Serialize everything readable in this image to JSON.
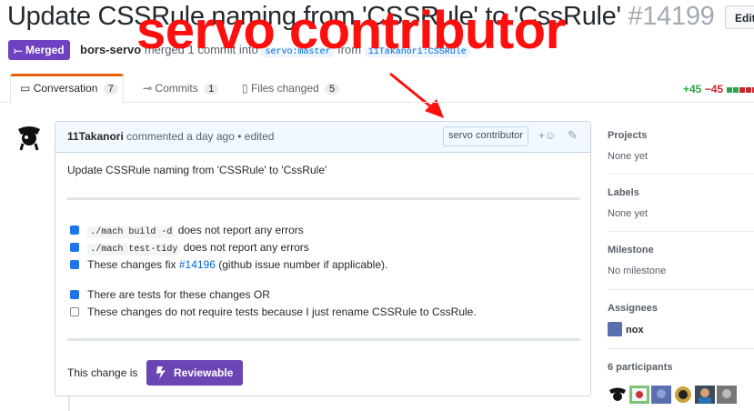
{
  "header": {
    "title": "Update CSSRule naming from 'CSSRule' to 'CssRule'",
    "number": "#14199",
    "edit_label": "Edit",
    "state_badge": "Merged",
    "author": "bors-servo",
    "meta_text": "merged 1 commit into",
    "base_branch": "servo:master",
    "head_branch": "11Takanori:CSSRule",
    "overlay_text": "servo contributor"
  },
  "tabs": [
    {
      "label": "Conversation",
      "count": "7",
      "icon": "comment-icon"
    },
    {
      "label": "Commits",
      "count": "1",
      "icon": "commit-icon"
    },
    {
      "label": "Files changed",
      "count": "5",
      "icon": "file-diff-icon"
    }
  ],
  "diffstat": {
    "additions": "+45",
    "deletions": "−45"
  },
  "comment": {
    "author": "11Takanori",
    "action_text": "commented a day ago • edited",
    "author_label": "servo contributor",
    "body": "Update CSSRule naming from 'CSSRule' to 'CssRule'",
    "tasks": [
      {
        "checked": true,
        "code": "./mach build -d",
        "text": "does not report any errors"
      },
      {
        "checked": true,
        "code": "./mach test-tidy",
        "text": "does not report any errors"
      },
      {
        "checked": true,
        "prefix": "These changes fix",
        "link": "#14196",
        "suffix": "(github issue number if applicable)."
      },
      {
        "checked": true,
        "text": "There are tests for these changes OR"
      },
      {
        "checked": false,
        "text": "These changes do not require tests because I just rename CSSRule to CssRule."
      }
    ],
    "review_prefix": "This change is",
    "review_button": "Reviewable"
  },
  "sidebar": {
    "projects": {
      "label": "Projects",
      "value": "None yet"
    },
    "labels": {
      "label": "Labels",
      "value": "None yet"
    },
    "milestone": {
      "label": "Milestone",
      "value": "No milestone"
    },
    "assignees": {
      "label": "Assignees",
      "value": "nox"
    },
    "participants": {
      "label": "6 participants"
    }
  },
  "colors": {
    "merged": "#6f42c1",
    "overlay": "#ff0e0e",
    "additions": "#28a745",
    "deletions": "#cb2431",
    "reviewable": "#6b45b3"
  }
}
